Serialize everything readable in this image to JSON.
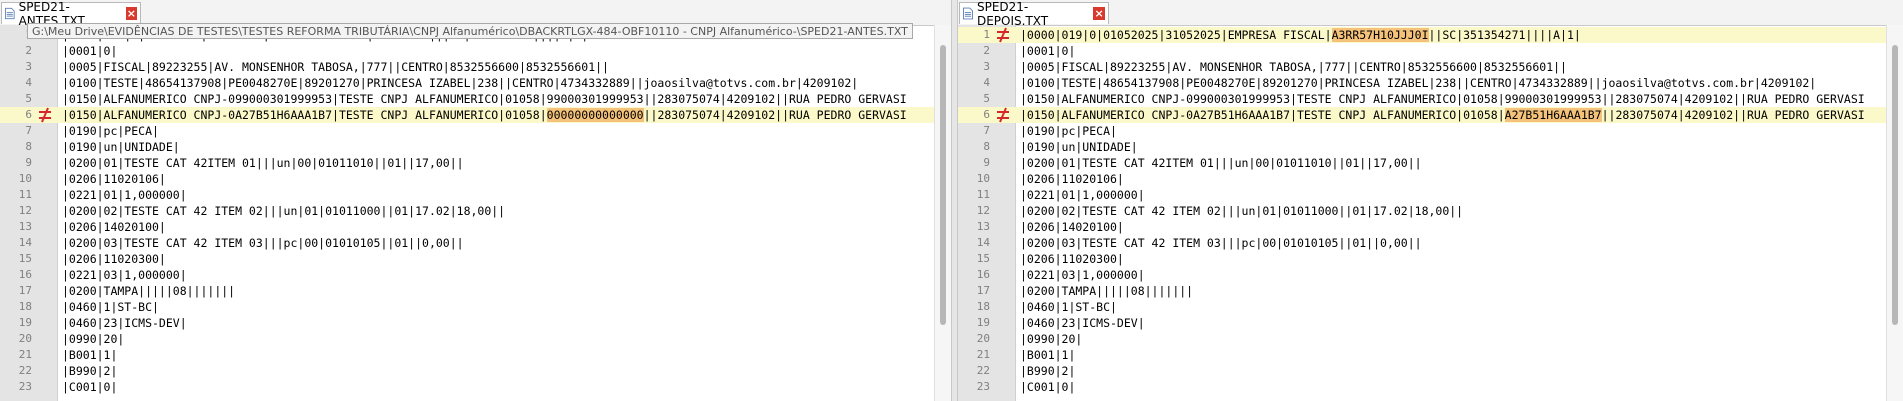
{
  "left": {
    "tab_title": "SPED21-ANTES.TXT",
    "tooltip_path": "G:\\Meu Drive\\EVIDÊNCIAS DE TESTES\\TESTES REFORMA TRIBUTÁRIA\\CNPJ Alfanumérico\\DBACKRTLGX-484-OBF10110 - CNPJ Alfanumérico-\\SPED21-ANTES.TXT",
    "lines": [
      {
        "n": "1",
        "text": "|0000|019|0|01052025|31052025|EMPRESA FISCAL|89223255|||SC|351354271||||A|1|",
        "changed": false,
        "pre": "",
        "hl": "",
        "post": ""
      },
      {
        "n": "2",
        "text": "|0001|0|",
        "changed": false,
        "pre": "",
        "hl": "",
        "post": ""
      },
      {
        "n": "3",
        "text": "|0005|FISCAL|89223255|AV. MONSENHOR TABOSA,|777||CENTRO|8532556600|8532556601||",
        "changed": false,
        "pre": "",
        "hl": "",
        "post": ""
      },
      {
        "n": "4",
        "text": "|0100|TESTE|48654137908|PE0048270E|89201270|PRINCESA IZABEL|238||CENTRO|4734332889||joaosilva@totvs.com.br|4209102|",
        "changed": false,
        "pre": "",
        "hl": "",
        "post": ""
      },
      {
        "n": "5",
        "text": "|0150|ALFANUMERICO CNPJ-099000301999953|TESTE CNPJ ALFANUMERICO|01058|99000301999953||283075074|4209102||RUA PEDRO GERVASI",
        "changed": false,
        "pre": "",
        "hl": "",
        "post": ""
      },
      {
        "n": "6",
        "text": "",
        "changed": true,
        "pre": "|0150|ALFANUMERICO CNPJ-0A27B51H6AAA1B7|TESTE CNPJ ALFANUMERICO|01058|",
        "hl": "00000000000000",
        "post": "||283075074|4209102||RUA PEDRO GERVASI"
      },
      {
        "n": "7",
        "text": "|0190|pc|PECA|",
        "changed": false,
        "pre": "",
        "hl": "",
        "post": ""
      },
      {
        "n": "8",
        "text": "|0190|un|UNIDADE|",
        "changed": false,
        "pre": "",
        "hl": "",
        "post": ""
      },
      {
        "n": "9",
        "text": "|0200|01|TESTE CAT 42ITEM 01|||un|00|01011010||01||17,00||",
        "changed": false,
        "pre": "",
        "hl": "",
        "post": ""
      },
      {
        "n": "10",
        "text": "|0206|11020106|",
        "changed": false,
        "pre": "",
        "hl": "",
        "post": ""
      },
      {
        "n": "11",
        "text": "|0221|01|1,000000|",
        "changed": false,
        "pre": "",
        "hl": "",
        "post": ""
      },
      {
        "n": "12",
        "text": "|0200|02|TESTE CAT 42 ITEM 02|||un|01|01011000||01|17.02|18,00||",
        "changed": false,
        "pre": "",
        "hl": "",
        "post": ""
      },
      {
        "n": "13",
        "text": "|0206|14020100|",
        "changed": false,
        "pre": "",
        "hl": "",
        "post": ""
      },
      {
        "n": "14",
        "text": "|0200|03|TESTE CAT 42 ITEM 03|||pc|00|01010105||01||0,00||",
        "changed": false,
        "pre": "",
        "hl": "",
        "post": ""
      },
      {
        "n": "15",
        "text": "|0206|11020300|",
        "changed": false,
        "pre": "",
        "hl": "",
        "post": ""
      },
      {
        "n": "16",
        "text": "|0221|03|1,000000|",
        "changed": false,
        "pre": "",
        "hl": "",
        "post": ""
      },
      {
        "n": "17",
        "text": "|0200|TAMPA|||||08|||||||",
        "changed": false,
        "pre": "",
        "hl": "",
        "post": ""
      },
      {
        "n": "18",
        "text": "|0460|1|ST-BC|",
        "changed": false,
        "pre": "",
        "hl": "",
        "post": ""
      },
      {
        "n": "19",
        "text": "|0460|23|ICMS-DEV|",
        "changed": false,
        "pre": "",
        "hl": "",
        "post": ""
      },
      {
        "n": "20",
        "text": "|0990|20|",
        "changed": false,
        "pre": "",
        "hl": "",
        "post": ""
      },
      {
        "n": "21",
        "text": "|B001|1|",
        "changed": false,
        "pre": "",
        "hl": "",
        "post": ""
      },
      {
        "n": "22",
        "text": "|B990|2|",
        "changed": false,
        "pre": "",
        "hl": "",
        "post": ""
      },
      {
        "n": "23",
        "text": "|C001|0|",
        "changed": false,
        "pre": "",
        "hl": "",
        "post": ""
      }
    ]
  },
  "right": {
    "tab_title": "SPED21-DEPOIS.TXT",
    "lines": [
      {
        "n": "1",
        "text": "",
        "changed": true,
        "pre": "|0000|019|0|01052025|31052025|EMPRESA FISCAL|",
        "hl": "A3RR57H10JJJ0I",
        "post": "||SC|351354271||||A|1|"
      },
      {
        "n": "2",
        "text": "|0001|0|",
        "changed": false,
        "pre": "",
        "hl": "",
        "post": ""
      },
      {
        "n": "3",
        "text": "|0005|FISCAL|89223255|AV. MONSENHOR TABOSA,|777||CENTRO|8532556600|8532556601||",
        "changed": false,
        "pre": "",
        "hl": "",
        "post": ""
      },
      {
        "n": "4",
        "text": "|0100|TESTE|48654137908|PE0048270E|89201270|PRINCESA IZABEL|238||CENTRO|4734332889||joaosilva@totvs.com.br|4209102|",
        "changed": false,
        "pre": "",
        "hl": "",
        "post": ""
      },
      {
        "n": "5",
        "text": "|0150|ALFANUMERICO CNPJ-099000301999953|TESTE CNPJ ALFANUMERICO|01058|99000301999953||283075074|4209102||RUA PEDRO GERVASI",
        "changed": false,
        "pre": "",
        "hl": "",
        "post": ""
      },
      {
        "n": "6",
        "text": "",
        "changed": true,
        "pre": "|0150|ALFANUMERICO CNPJ-0A27B51H6AAA1B7|TESTE CNPJ ALFANUMERICO|01058|",
        "hl": "A27B51H6AAA1B7",
        "post": "||283075074|4209102||RUA PEDRO GERVASI"
      },
      {
        "n": "7",
        "text": "|0190|pc|PECA|",
        "changed": false,
        "pre": "",
        "hl": "",
        "post": ""
      },
      {
        "n": "8",
        "text": "|0190|un|UNIDADE|",
        "changed": false,
        "pre": "",
        "hl": "",
        "post": ""
      },
      {
        "n": "9",
        "text": "|0200|01|TESTE CAT 42ITEM 01|||un|00|01011010||01||17,00||",
        "changed": false,
        "pre": "",
        "hl": "",
        "post": ""
      },
      {
        "n": "10",
        "text": "|0206|11020106|",
        "changed": false,
        "pre": "",
        "hl": "",
        "post": ""
      },
      {
        "n": "11",
        "text": "|0221|01|1,000000|",
        "changed": false,
        "pre": "",
        "hl": "",
        "post": ""
      },
      {
        "n": "12",
        "text": "|0200|02|TESTE CAT 42 ITEM 02|||un|01|01011000||01|17.02|18,00||",
        "changed": false,
        "pre": "",
        "hl": "",
        "post": ""
      },
      {
        "n": "13",
        "text": "|0206|14020100|",
        "changed": false,
        "pre": "",
        "hl": "",
        "post": ""
      },
      {
        "n": "14",
        "text": "|0200|03|TESTE CAT 42 ITEM 03|||pc|00|01010105||01||0,00||",
        "changed": false,
        "pre": "",
        "hl": "",
        "post": ""
      },
      {
        "n": "15",
        "text": "|0206|11020300|",
        "changed": false,
        "pre": "",
        "hl": "",
        "post": ""
      },
      {
        "n": "16",
        "text": "|0221|03|1,000000|",
        "changed": false,
        "pre": "",
        "hl": "",
        "post": ""
      },
      {
        "n": "17",
        "text": "|0200|TAMPA|||||08|||||||",
        "changed": false,
        "pre": "",
        "hl": "",
        "post": ""
      },
      {
        "n": "18",
        "text": "|0460|1|ST-BC|",
        "changed": false,
        "pre": "",
        "hl": "",
        "post": ""
      },
      {
        "n": "19",
        "text": "|0460|23|ICMS-DEV|",
        "changed": false,
        "pre": "",
        "hl": "",
        "post": ""
      },
      {
        "n": "20",
        "text": "|0990|20|",
        "changed": false,
        "pre": "",
        "hl": "",
        "post": ""
      },
      {
        "n": "21",
        "text": "|B001|1|",
        "changed": false,
        "pre": "",
        "hl": "",
        "post": ""
      },
      {
        "n": "22",
        "text": "|B990|2|",
        "changed": false,
        "pre": "",
        "hl": "",
        "post": ""
      },
      {
        "n": "23",
        "text": "|C001|0|",
        "changed": false,
        "pre": "",
        "hl": "",
        "post": ""
      }
    ]
  },
  "icons": {
    "file": "file-icon",
    "close": "close-icon",
    "diff": "diff-change-icon"
  },
  "colors": {
    "changed_line_bg": "#fbf9c9",
    "changed_token_bg": "#f4c27a",
    "tab_close_bg": "#d83b2d",
    "diff_mark": "#d4282a"
  }
}
